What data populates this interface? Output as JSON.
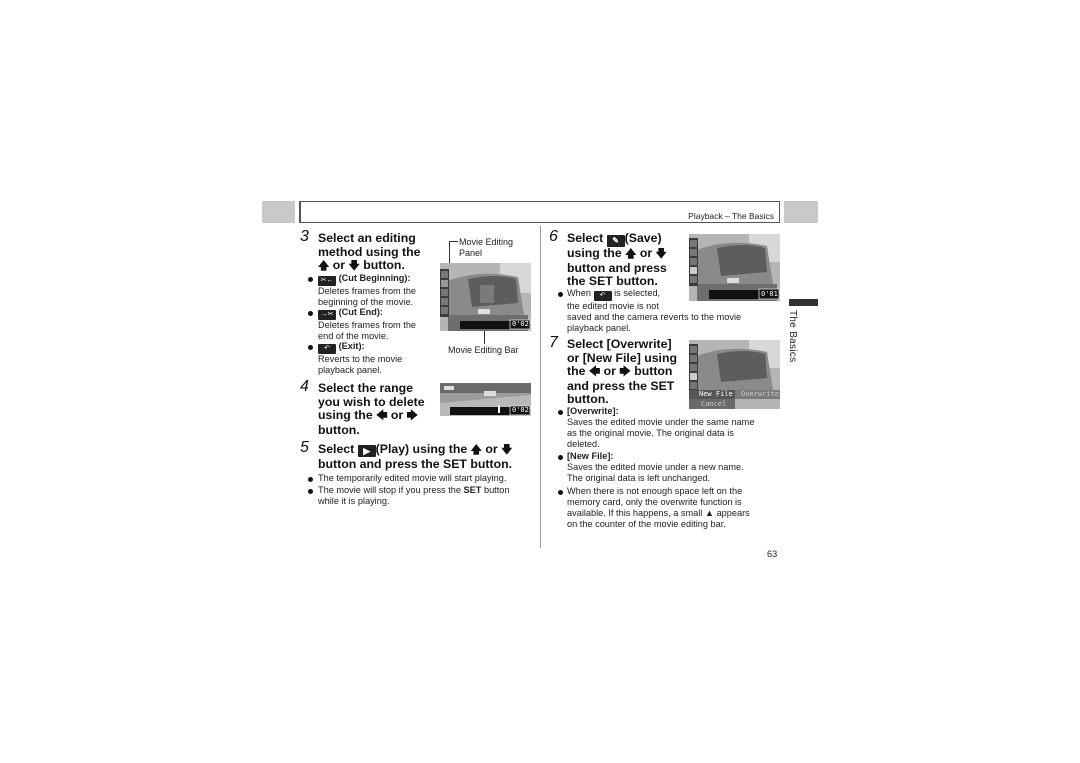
{
  "header": {
    "section_title": "Playback – The Basics"
  },
  "side_tab": {
    "label": "The Basics"
  },
  "page_number": "63",
  "step3": {
    "number": "3",
    "title_lines": [
      "Select an editing",
      "method using the",
      "or",
      "button."
    ],
    "items": [
      {
        "icon": "cut-beginning-icon",
        "icon_glyph": "✂←",
        "label": "(Cut Beginning):",
        "desc_lines": [
          "Deletes frames from the",
          "beginning of the movie."
        ]
      },
      {
        "icon": "cut-end-icon",
        "icon_glyph": "→✂",
        "label": "(Cut End):",
        "desc_lines": [
          "Deletes frames from the",
          "end of the movie."
        ]
      },
      {
        "icon": "exit-icon",
        "icon_glyph": "↶",
        "label": "(Exit):",
        "desc_lines": [
          "Reverts to the movie",
          "playback panel."
        ]
      }
    ],
    "callouts": {
      "panel_label_lines": [
        "Movie Editing",
        "Panel"
      ],
      "bar_label": "Movie Editing Bar"
    },
    "screen_counter": "0'02\""
  },
  "step4": {
    "number": "4",
    "title_lines": [
      "Select the range",
      "you wish to delete",
      "using the",
      "or",
      "button."
    ],
    "screen_counter": "0'02\""
  },
  "step5": {
    "number": "5",
    "title_line1_a": "Select",
    "title_line1_b": "(Play) using the",
    "title_line1_c": "or",
    "title_line2": "button and press the SET button.",
    "bullets": [
      {
        "text": "The temporarily edited movie will start playing."
      },
      {
        "text_a": "The movie will stop if you press the ",
        "bold": "SET",
        "text_b": " button",
        "line2": "while it is playing."
      }
    ]
  },
  "step6": {
    "number": "6",
    "title_a": "Select",
    "title_b": "(Save)",
    "title_lines": [
      "using the",
      "or",
      "button and press",
      "the SET button."
    ],
    "bullet": {
      "text_a": "When",
      "text_b": "is selected,",
      "line2": "the edited movie is not",
      "line3": "saved and the camera reverts to the movie",
      "line4": "playback panel."
    },
    "screen_counter": "0'01\""
  },
  "step7": {
    "number": "7",
    "title_lines": [
      "Select [Overwrite]",
      "or [New File] using",
      "the",
      "or",
      "button",
      "and press the SET",
      "button."
    ],
    "screen_menu": {
      "new_file": "New File",
      "overwrite": "Overwrite",
      "cancel": "Cancel"
    },
    "bullets": [
      {
        "label": "[Overwrite]:",
        "lines": [
          "Saves the edited movie under the same name",
          "as the original movie. The original data is",
          "deleted."
        ]
      },
      {
        "label": "[New File]:",
        "lines": [
          "Saves the edited movie under a new name.",
          "The original data is left unchanged."
        ]
      },
      {
        "lines": [
          "When there is not enough space left on the",
          "memory card, only the overwrite function is"
        ],
        "line3_a": "available. If this happens, a small",
        "line3_b": "appears",
        "line4": "on the counter of the movie editing bar."
      }
    ]
  }
}
